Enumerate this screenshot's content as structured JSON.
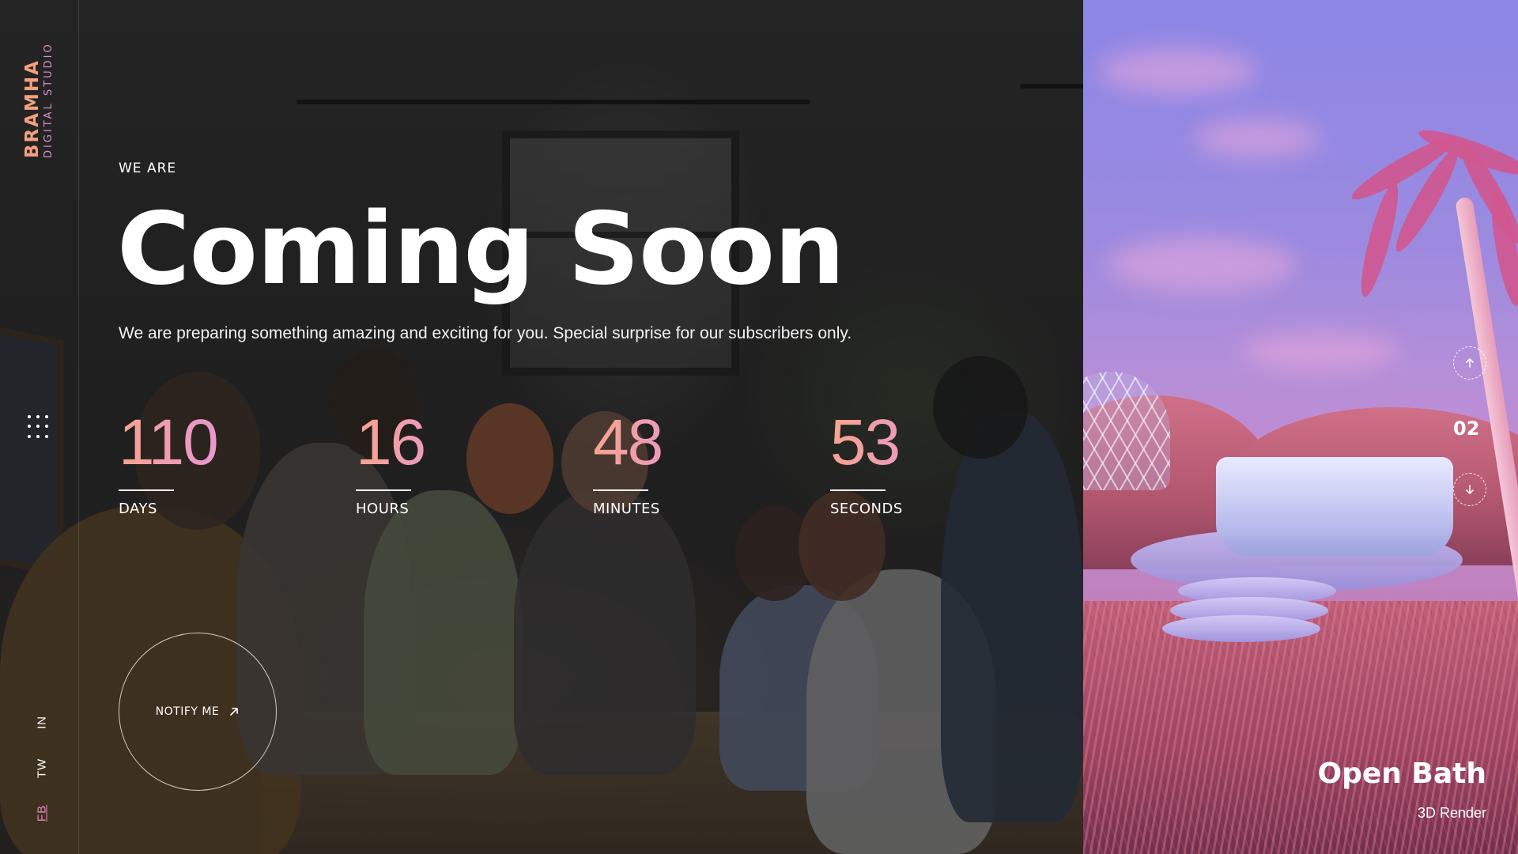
{
  "brand": {
    "name": "BRAMHA",
    "subtitle": "DIGITAL STUDIO"
  },
  "hero": {
    "eyebrow": "WE ARE",
    "title": "Coming Soon",
    "description": "We are preparing something amazing and exciting for you. Special surprise for our subscribers only."
  },
  "countdown": [
    {
      "value": "110",
      "label": "DAYS"
    },
    {
      "value": "16",
      "label": "HOURS"
    },
    {
      "value": "48",
      "label": "MINUTES"
    },
    {
      "value": "53",
      "label": "SECONDS"
    }
  ],
  "notify": {
    "label": "NOTIFY ME",
    "icon": "arrow-up-right-icon"
  },
  "social": [
    {
      "label": "IN"
    },
    {
      "label": "TW"
    },
    {
      "label": "FB",
      "active": true
    }
  ],
  "menu": {
    "icon": "dots-grid-icon"
  },
  "slider": {
    "index": "02",
    "prev_icon": "arrow-up-icon",
    "next_icon": "arrow-down-icon",
    "title": "Open Bath",
    "subtitle": "3D Render"
  },
  "colors": {
    "accent_start": "#f6a48d",
    "accent_end": "#f19fd8",
    "brand": "#f2a07f",
    "social_active": "#e586c7"
  }
}
